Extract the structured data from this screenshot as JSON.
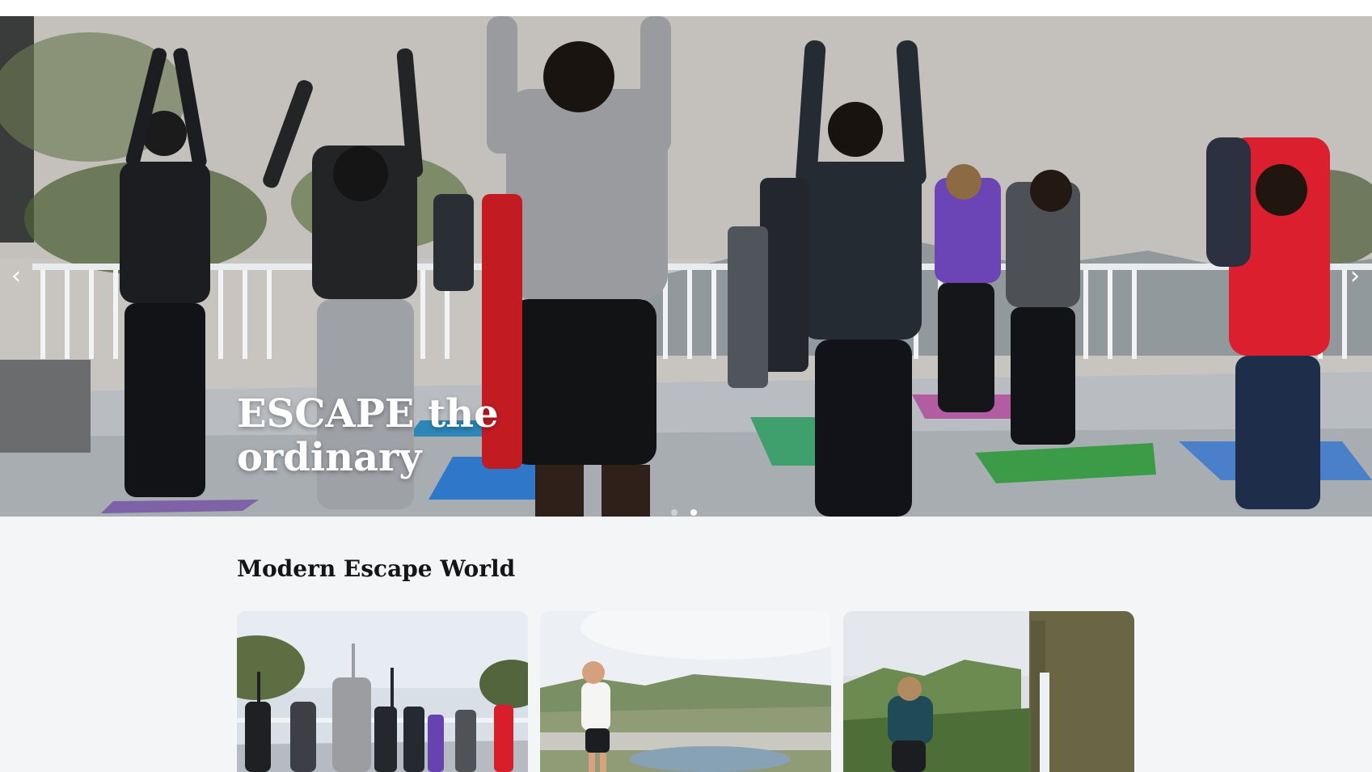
{
  "hero": {
    "title": "ESCAPE the ordinary",
    "prev_icon": "‹",
    "next_icon": "›",
    "slides": [
      {
        "label": "slide 1",
        "active": false
      },
      {
        "label": "slide 2",
        "active": true
      }
    ]
  },
  "section": {
    "title": "Modern Escape World"
  },
  "cards": [
    {
      "image": "yoga group on mountain terrace"
    },
    {
      "image": "woman overlooking lake and village"
    },
    {
      "image": "woman looking at waterfall"
    }
  ],
  "colors": {
    "page_bg": "#f4f5f7",
    "text_dark": "#151515",
    "hero_text": "#ffffff"
  }
}
